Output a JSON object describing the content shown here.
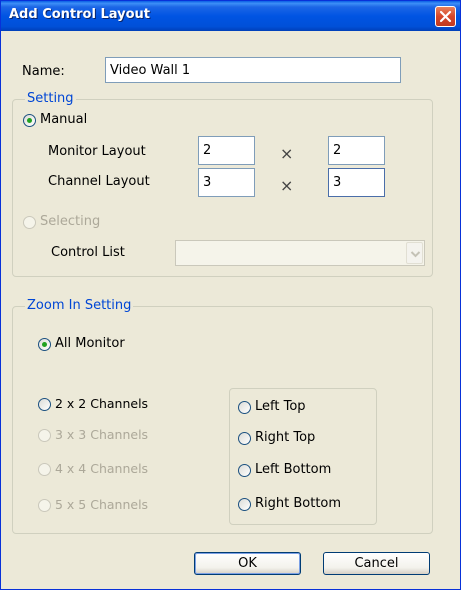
{
  "window": {
    "title": "Add Control Layout"
  },
  "name": {
    "label": "Name:",
    "value": "Video Wall 1"
  },
  "setting": {
    "legend": "Setting",
    "manual_label": "Manual",
    "monitor_layout_label": "Monitor Layout",
    "monitor_cols": "2",
    "monitor_rows": "2",
    "channel_layout_label": "Channel Layout",
    "channel_cols": "3",
    "channel_rows": "3",
    "times_symbol": "×",
    "selecting_label": "Selecting",
    "control_list_label": "Control List",
    "control_list_value": ""
  },
  "zoom": {
    "legend": "Zoom In Setting",
    "all_monitor_label": "All Monitor",
    "ch2_label": "2 x 2 Channels",
    "ch3_label": "3 x 3 Channels",
    "ch4_label": "4 x 4 Channels",
    "ch5_label": "5 x 5 Channels",
    "left_top_label": "Left Top",
    "right_top_label": "Right Top",
    "left_bottom_label": "Left Bottom",
    "right_bottom_label": "Right Bottom"
  },
  "buttons": {
    "ok_label": "OK",
    "cancel_label": "Cancel"
  },
  "icons": {
    "close": "close-icon",
    "dropdown": "chevron-down-icon"
  }
}
